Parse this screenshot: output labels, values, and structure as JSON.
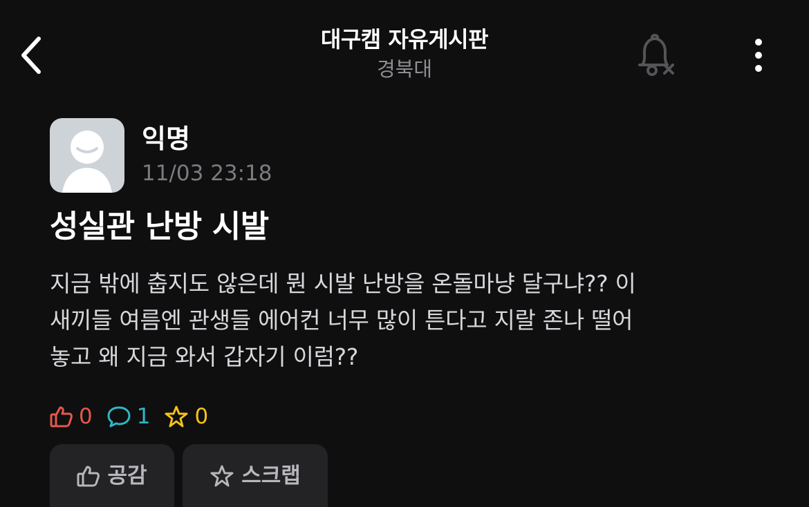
{
  "header": {
    "back_icon": "chevron-left-icon",
    "title": "대구캠 자유게시판",
    "subtitle": "경북대",
    "notification_icon": "bell-off-icon",
    "more_icon": "more-vertical-icon"
  },
  "post": {
    "author": "익명",
    "timestamp": "11/03 23:18",
    "title": "성실관 난방 시발",
    "body_lines": [
      "지금 밖에 춥지도 않은데 뭔 시발 난방을 온돌마냥 달구냐?? 이",
      "새끼들 여름엔 관생들 에어컨 너무 많이 튼다고 지랄 존나 떨어",
      "놓고 왜 지금 와서 갑자기 이럼??"
    ],
    "stats": {
      "likes": "0",
      "comments": "1",
      "scraps": "0"
    }
  },
  "actions": {
    "like_label": "공감",
    "scrap_label": "스크랩"
  },
  "colors": {
    "background": "#0f0f10",
    "like": "#e4584c",
    "comment": "#2eb8c6",
    "scrap": "#f4c21d",
    "button_bg": "#232325"
  }
}
